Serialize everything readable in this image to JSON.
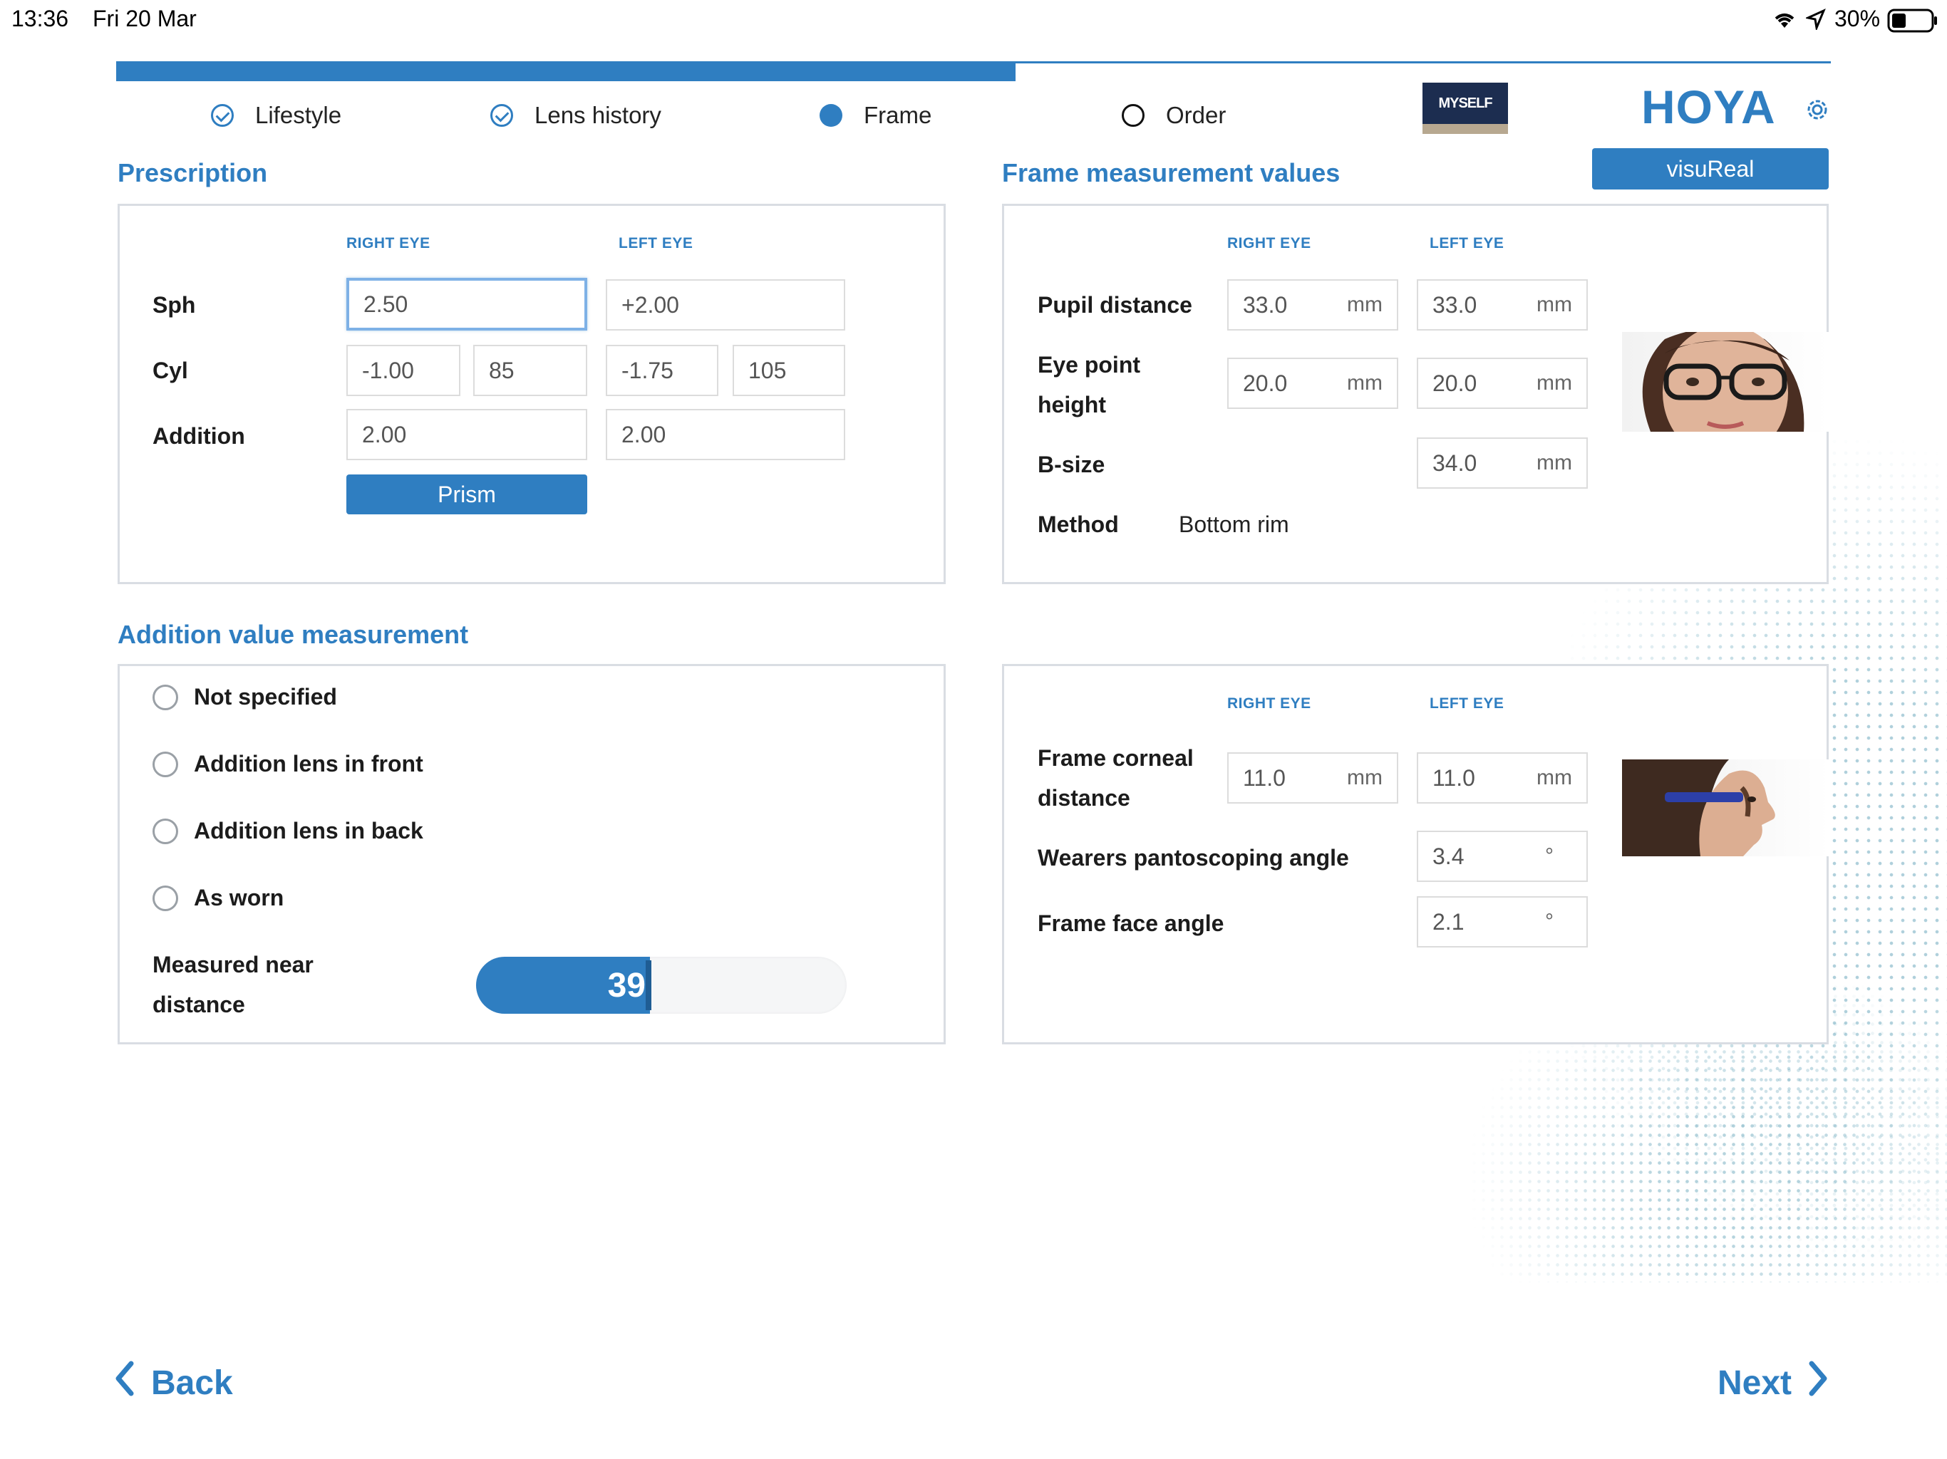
{
  "status_bar": {
    "time": "13:36",
    "date": "Fri 20 Mar",
    "battery": "30%"
  },
  "progress": {
    "completed_fraction": 0.5
  },
  "steps": [
    {
      "label": "Lifestyle",
      "state": "done"
    },
    {
      "label": "Lens history",
      "state": "done"
    },
    {
      "label": "Frame",
      "state": "active"
    },
    {
      "label": "Order",
      "state": "todo"
    }
  ],
  "brand": {
    "myself_badge": "MYSELF",
    "logo": "HOYA"
  },
  "prescription": {
    "title": "Prescription",
    "right_eye_header": "RIGHT EYE",
    "left_eye_header": "LEFT EYE",
    "sph_label": "Sph",
    "cyl_label": "Cyl",
    "addition_label": "Addition",
    "right": {
      "sph": "2.50",
      "cyl": "-1.00",
      "axis": "85",
      "addition": "2.00"
    },
    "left": {
      "sph": "+2.00",
      "cyl": "-1.75",
      "axis": "105",
      "addition": "2.00"
    },
    "prism_button": "Prism"
  },
  "frame_values": {
    "title": "Frame measurement values",
    "visureal_button": "visuReal",
    "right_eye_header": "RIGHT EYE",
    "left_eye_header": "LEFT EYE",
    "pupil_distance_label": "Pupil distance",
    "eye_point_height_label_1": "Eye point",
    "eye_point_height_label_2": "height",
    "bsize_label": "B-size",
    "method_label": "Method",
    "method_value": "Bottom rim",
    "unit_mm": "mm",
    "right": {
      "pupil_distance": "33.0",
      "eye_point_height": "20.0"
    },
    "left": {
      "pupil_distance": "33.0",
      "eye_point_height": "20.0",
      "bsize": "34.0"
    }
  },
  "addition_measurement": {
    "title": "Addition value measurement",
    "options": [
      "Not specified",
      "Addition lens in front",
      "Addition lens in back",
      "As worn"
    ],
    "near_distance_label_1": "Measured near",
    "near_distance_label_2": "distance",
    "near_distance_value": "39",
    "near_distance_fraction": 0.47
  },
  "fitting": {
    "right_eye_header": "RIGHT EYE",
    "left_eye_header": "LEFT EYE",
    "corneal_label_1": "Frame corneal",
    "corneal_label_2": "distance",
    "pantoscopic_label": "Wearers pantoscoping angle",
    "face_angle_label": "Frame face angle",
    "unit_mm": "mm",
    "unit_deg": "°",
    "right": {
      "corneal_distance": "11.0"
    },
    "left": {
      "corneal_distance": "11.0",
      "pantoscopic_angle": "3.4",
      "face_angle": "2.1"
    }
  },
  "nav": {
    "back": "Back",
    "next": "Next"
  },
  "colors": {
    "accent": "#2f7ec1"
  }
}
